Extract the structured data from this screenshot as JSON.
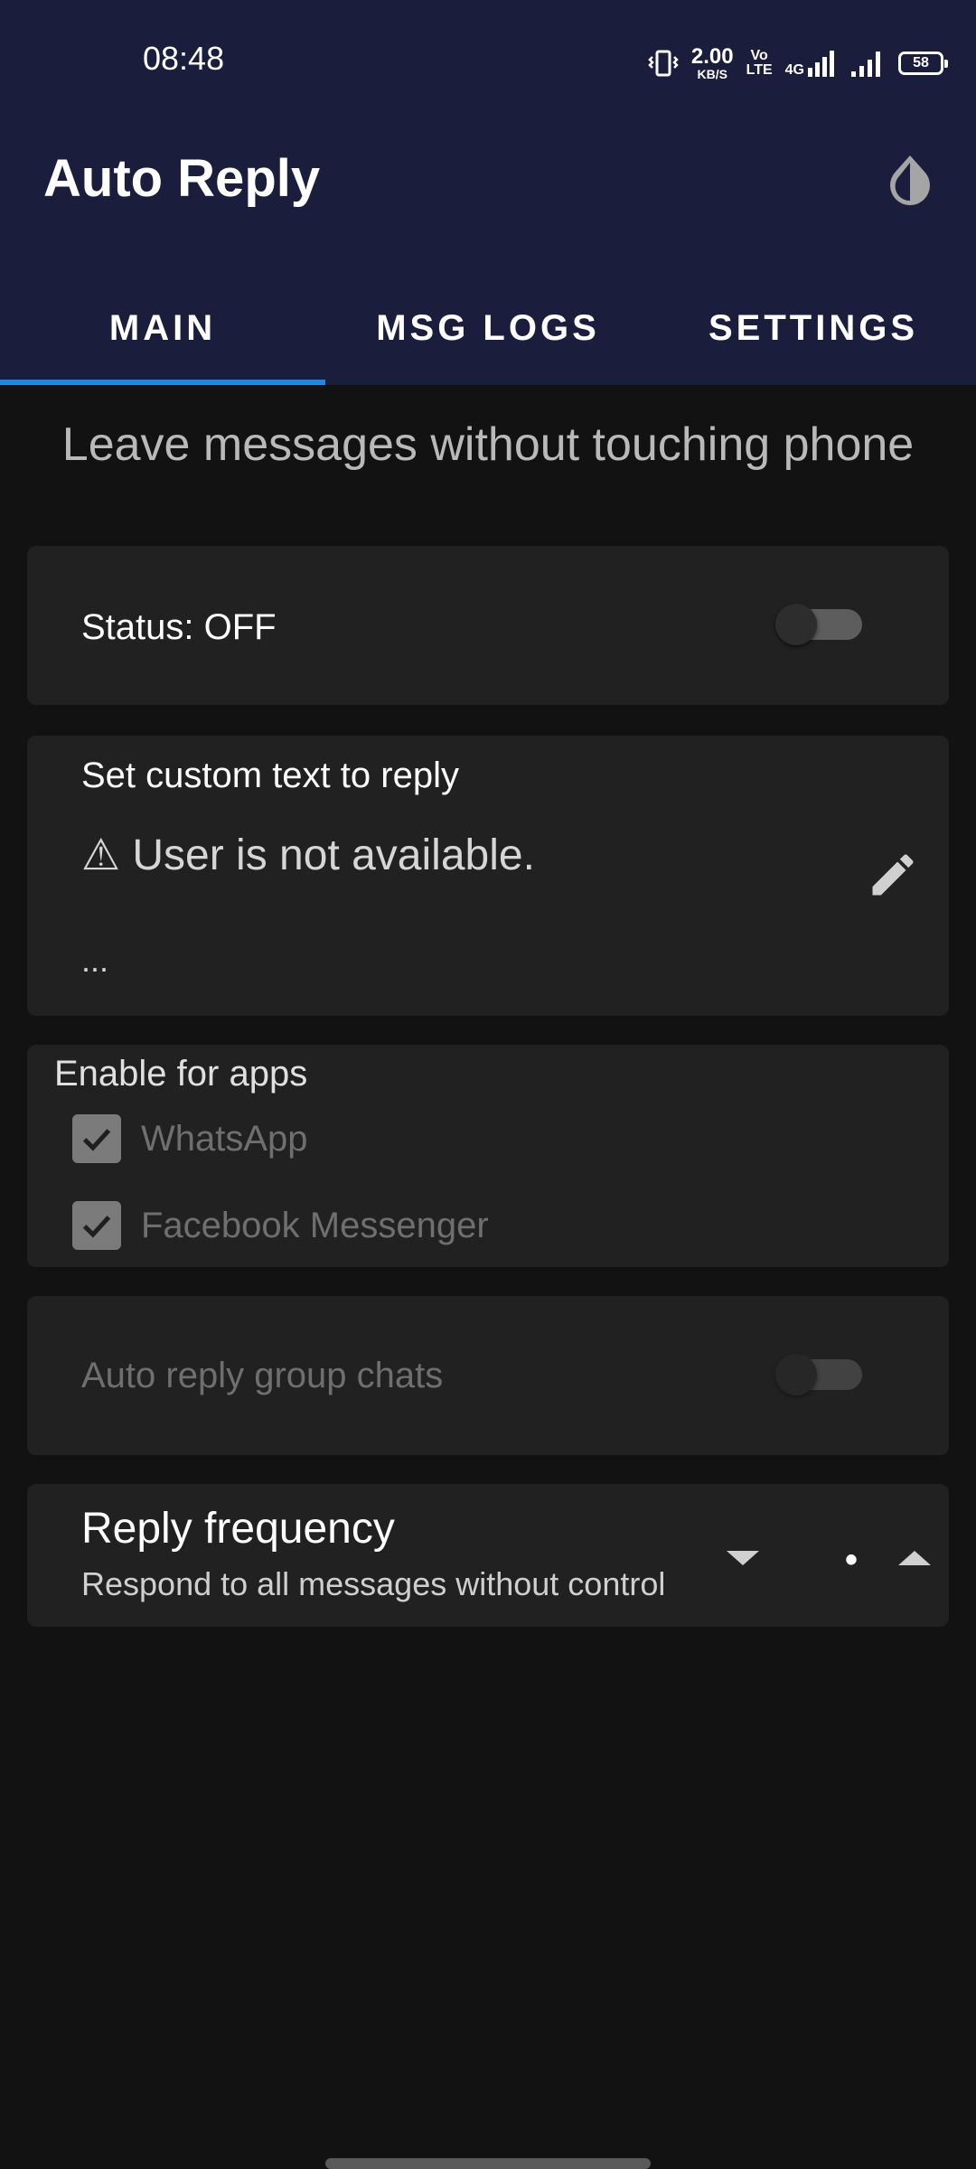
{
  "status_bar": {
    "time": "08:48",
    "net_speed": "2.00",
    "net_speed_unit": "KB/S",
    "volte_top": "Vo",
    "volte_bottom": "LTE",
    "network": "4G",
    "battery": "58",
    "icons": [
      "vibrate-icon",
      "signal-icon",
      "signal-icon-2"
    ]
  },
  "app_bar": {
    "title": "Auto Reply",
    "theme_icon": "invert-colors-icon"
  },
  "tabs": [
    {
      "label": "MAIN",
      "active": true
    },
    {
      "label": "MSG LOGS",
      "active": false
    },
    {
      "label": "SETTINGS",
      "active": false
    }
  ],
  "main": {
    "tagline": "Leave messages without touching phone",
    "status": {
      "label": "Status: OFF",
      "toggle_on": false
    },
    "custom_reply": {
      "title": "Set custom text to reply",
      "text": "⚠ User is not available.",
      "more": "...",
      "edit_icon": "pencil-icon"
    },
    "enable_apps": {
      "title": "Enable for apps",
      "apps": [
        {
          "label": "WhatsApp",
          "checked": true
        },
        {
          "label": "Facebook Messenger",
          "checked": true
        }
      ]
    },
    "group_chats": {
      "label": "Auto reply group chats",
      "toggle_on": false
    },
    "reply_frequency": {
      "title": "Reply frequency",
      "subtitle": "Respond to all messages without control",
      "value": "•"
    }
  },
  "colors": {
    "app_bar": "#1a1d3b",
    "background": "#121212",
    "card": "#212121",
    "accent": "#1e88e5"
  }
}
